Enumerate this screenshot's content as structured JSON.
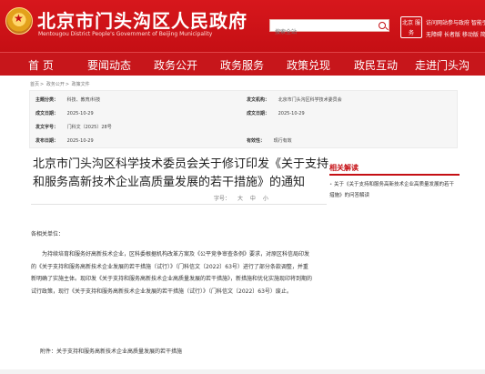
{
  "header": {
    "site_title": "北京市门头沟区人民政府",
    "site_subtitle": "Mentougou District People's Government of Beijing Municipality",
    "search_placeholder": "搜索全站",
    "service_logo": "北京 服务",
    "tools_line1": "访问网站参与政府 智能引擎",
    "tools_line2": "无障碍 长者版 移动版 简"
  },
  "nav": {
    "items": [
      "首 页",
      "要闻动态",
      "政务公开",
      "政务服务",
      "政策兑现",
      "政民互动",
      "走进门头沟"
    ]
  },
  "breadcrumb": {
    "items": [
      "首页",
      "政务公开",
      "政策文件"
    ]
  },
  "meta": {
    "rows": [
      {
        "label1": "主题分类：",
        "value1": "科技、教育/科技",
        "label2": "发文机构：",
        "value2": "北京市门头沟区科学技术委员会"
      },
      {
        "label1": "成文日期：",
        "value1": "2025-10-29",
        "label2": "成文日期：",
        "value2": "2025-10-29"
      },
      {
        "label1": "发文字号：",
        "value1": "门科文〔2025〕28号",
        "label2": "",
        "value2": ""
      },
      {
        "label1": "发布日期：",
        "value1": "2025-10-29",
        "label2": "有效性：",
        "value2": "现行有效"
      }
    ]
  },
  "article": {
    "title": "北京市门头沟区科学技术委员会关于修订印发《关于支持和服务高新技术企业高质量发展的若干措施》的通知",
    "toolbar": {
      "font_label": "字号：",
      "large": "大",
      "medium": "中",
      "small": "小"
    },
    "salutation": "各相关单位：",
    "paragraph": "为持续培育和服务好高新技术企业，区科委根据机构改革方案及《公平竞争审查条例》要求，对原区科信局印发的《关于支持和服务高新技术企业发展的若干措施（试行）》（门科信文〔2022〕63号）进行了部分条款调整，并重新明确了实施主体。现印发《关于支持和服务高新技术企业高质量发展的若干措施》，新措施和优化实施现印将到期的试行政策，现行《关于支持和服务高新技术企业发展的若干措施（试行）》（门科信文〔2022〕63号）废止。",
    "attachment": "附件：关于支持和服务高新技术企业高质量发展的若干措施"
  },
  "related": {
    "title": "相关解读",
    "items": [
      "关于《关于支持和服务高新技术企业高质量发展的若干措施》的问答解读"
    ]
  },
  "colors": {
    "brand_red": "#c50f14",
    "nav_red": "#c7161b"
  }
}
